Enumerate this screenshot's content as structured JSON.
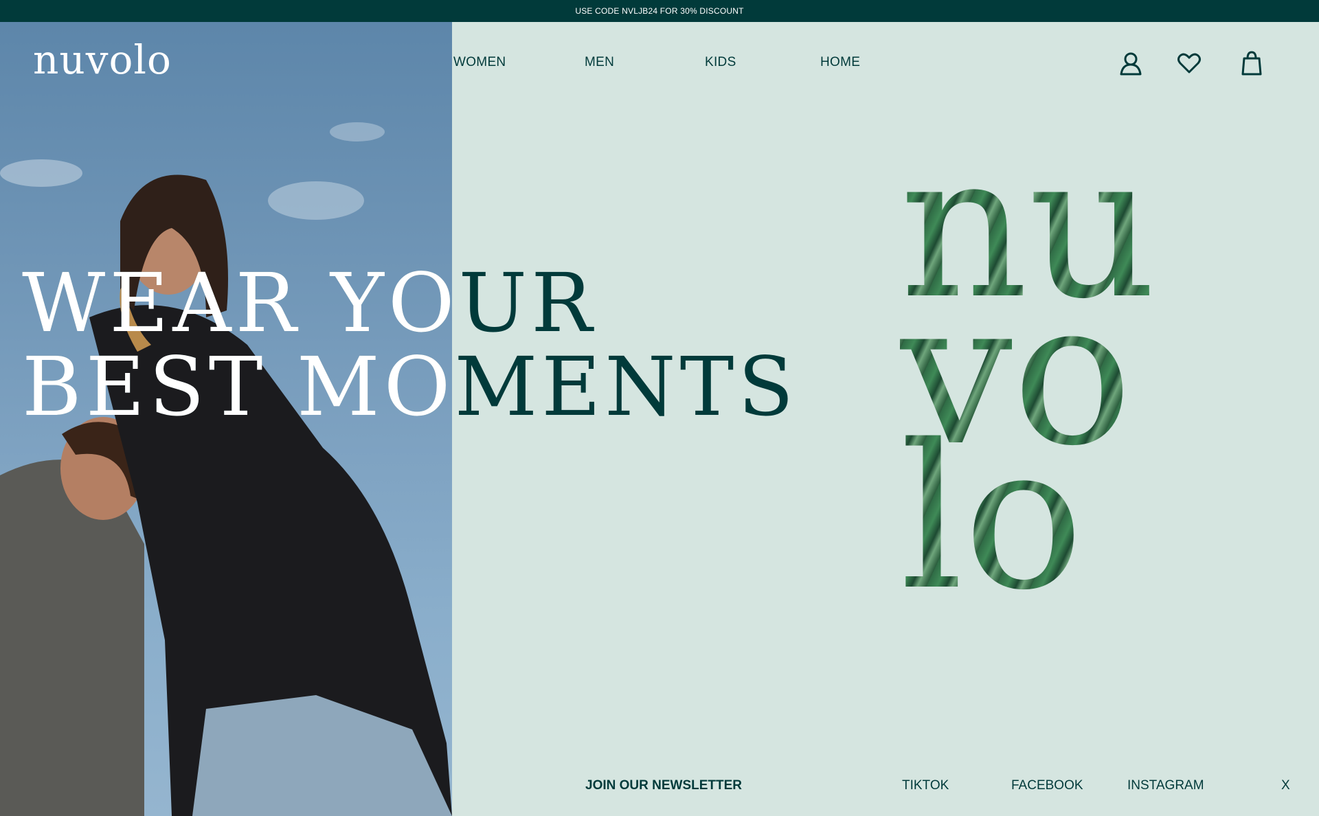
{
  "announcement": "USE CODE NVLJB24 FOR 30% DISCOUNT",
  "brand": "nuvolo",
  "nav": {
    "women": "WOMEN",
    "men": "MEN",
    "kids": "KIDS",
    "home": "HOME"
  },
  "icons": [
    "user-icon",
    "heart-icon",
    "shopping-bag-icon"
  ],
  "hero": {
    "line1": "WEAR YOUR",
    "line2": "BEST MOMENTS"
  },
  "big_logo": {
    "row1": "nu",
    "row2": "vo",
    "row3": "lo"
  },
  "footer": {
    "newsletter": "JOIN OUR NEWSLETTER",
    "tiktok": "TIKTOK",
    "facebook": "FACEBOOK",
    "instagram": "INSTAGRAM",
    "close": "X"
  },
  "colors": {
    "primary": "#013a3a",
    "background": "#d5e5e0",
    "text_on_photo": "#ffffff"
  }
}
